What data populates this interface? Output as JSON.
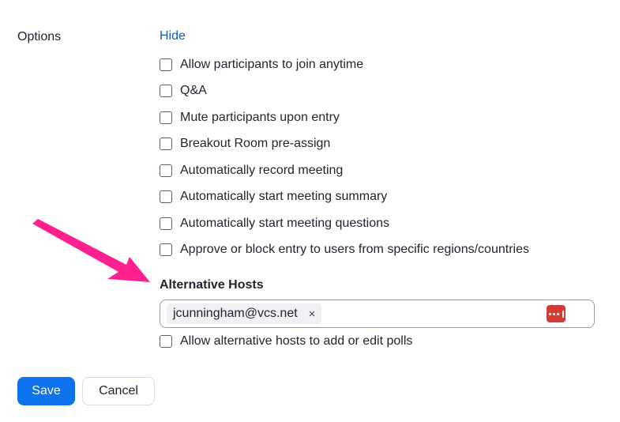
{
  "options": {
    "label": "Options",
    "toggle_label": "Hide",
    "items": [
      {
        "label": "Allow participants to join anytime",
        "checked": false
      },
      {
        "label": "Q&A",
        "checked": false
      },
      {
        "label": "Mute participants upon entry",
        "checked": false
      },
      {
        "label": "Breakout Room pre-assign",
        "checked": false
      },
      {
        "label": "Automatically record meeting",
        "checked": false
      },
      {
        "label": "Automatically start meeting summary",
        "checked": false
      },
      {
        "label": "Automatically start meeting questions",
        "checked": false
      },
      {
        "label": "Approve or block entry to users from specific regions/countries",
        "checked": false
      }
    ]
  },
  "alternative_hosts": {
    "title": "Alternative Hosts",
    "hosts": [
      "jcunningham@vcs.net"
    ],
    "remove_glyph": "×",
    "password_manager_icon": "password-manager-icon",
    "allow_polls": {
      "label": "Allow alternative hosts to add or edit polls",
      "checked": false
    }
  },
  "actions": {
    "save_label": "Save",
    "cancel_label": "Cancel"
  },
  "colors": {
    "link": "#0e5dbb",
    "primary": "#0e72ed",
    "annotation_arrow": "#ff1f8e",
    "password_icon": "#d43b34"
  }
}
